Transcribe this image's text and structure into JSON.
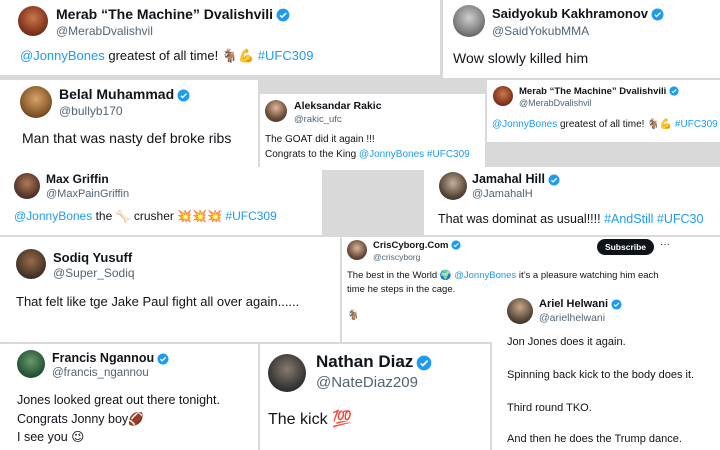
{
  "tweets": [
    {
      "name": "Merab “The Machine” Dvalishvili",
      "handle": "@MerabDvalishvil",
      "t1": "@JonnyBones",
      "t2": " greatest of all time! ",
      "e": "🐐💪",
      "t3": " #UFC309"
    },
    {
      "name": "Saidyokub Kakhramonov",
      "handle": "@SaidYokubMMA",
      "text": "Wow slowly killed him"
    },
    {
      "name": "Belal Muhammad",
      "handle": "@bullyb170",
      "text": "Man that was nasty def broke ribs"
    },
    {
      "name": "Aleksandar Rakic",
      "handle": "@rakic_ufc",
      "line1": "The GOAT did it again !!!",
      "line2a": "Congrats to the King ",
      "line2b": "@JonnyBones #UFC309"
    },
    {
      "name": "Merab “The Machine” Dvalishvili",
      "handle": "@MerabDvalishvil",
      "t1": "@JonnyBones",
      "t2": " greatest of all time! ",
      "e": "🐐💪",
      "t3": " #UFC309"
    },
    {
      "name": "Max Griffin",
      "handle": "@MaxPainGriffin",
      "t1": "@JonnyBones",
      "t2": " the ",
      "e1": "🦴",
      "t3": " crusher ",
      "e2": "💥💥💥",
      "t4": " #UFC309"
    },
    {
      "name": "Jamahal Hill",
      "handle": "@JamahalH",
      "t1": "That was dominat as usual!!!! ",
      "t2": "#AndStill #UFC30"
    },
    {
      "name": "Sodiq Yusuff",
      "handle": "@Super_Sodiq",
      "text": "That felt like tge Jake Paul fight all over again......"
    },
    {
      "name": "CrisCyborg.Com",
      "handle": "@criscyborg",
      "subscribe": "Subscribe",
      "more": "···",
      "line1a": "The best in the World ",
      "e": "🌍",
      "line1b": " @JonnyBones",
      "line1c": " it’s a pleasure watching him each",
      "line2": "time he steps in the cage.",
      "e2": "🐐"
    },
    {
      "name": "Ariel Helwani",
      "handle": "@arielhelwani",
      "p1": "Jon Jones does it again.",
      "p2": "Spinning back kick to the body does it.",
      "p3": "Third round TKO.",
      "p4": "And then he does the Trump dance."
    },
    {
      "name": "Francis Ngannou",
      "handle": "@francis_ngannou",
      "l1": "Jones looked great out there tonight.",
      "l2": "Congrats Jonny boy",
      "e2": "🏈",
      "l3": "I see you ",
      "e3": "😉"
    },
    {
      "name": "Nathan Diaz",
      "handle": "@NateDiaz209",
      "text": "The kick ",
      "e": "💯"
    }
  ],
  "colors": {
    "link": "#1d9bf0",
    "verified": "#1d9bf0"
  }
}
